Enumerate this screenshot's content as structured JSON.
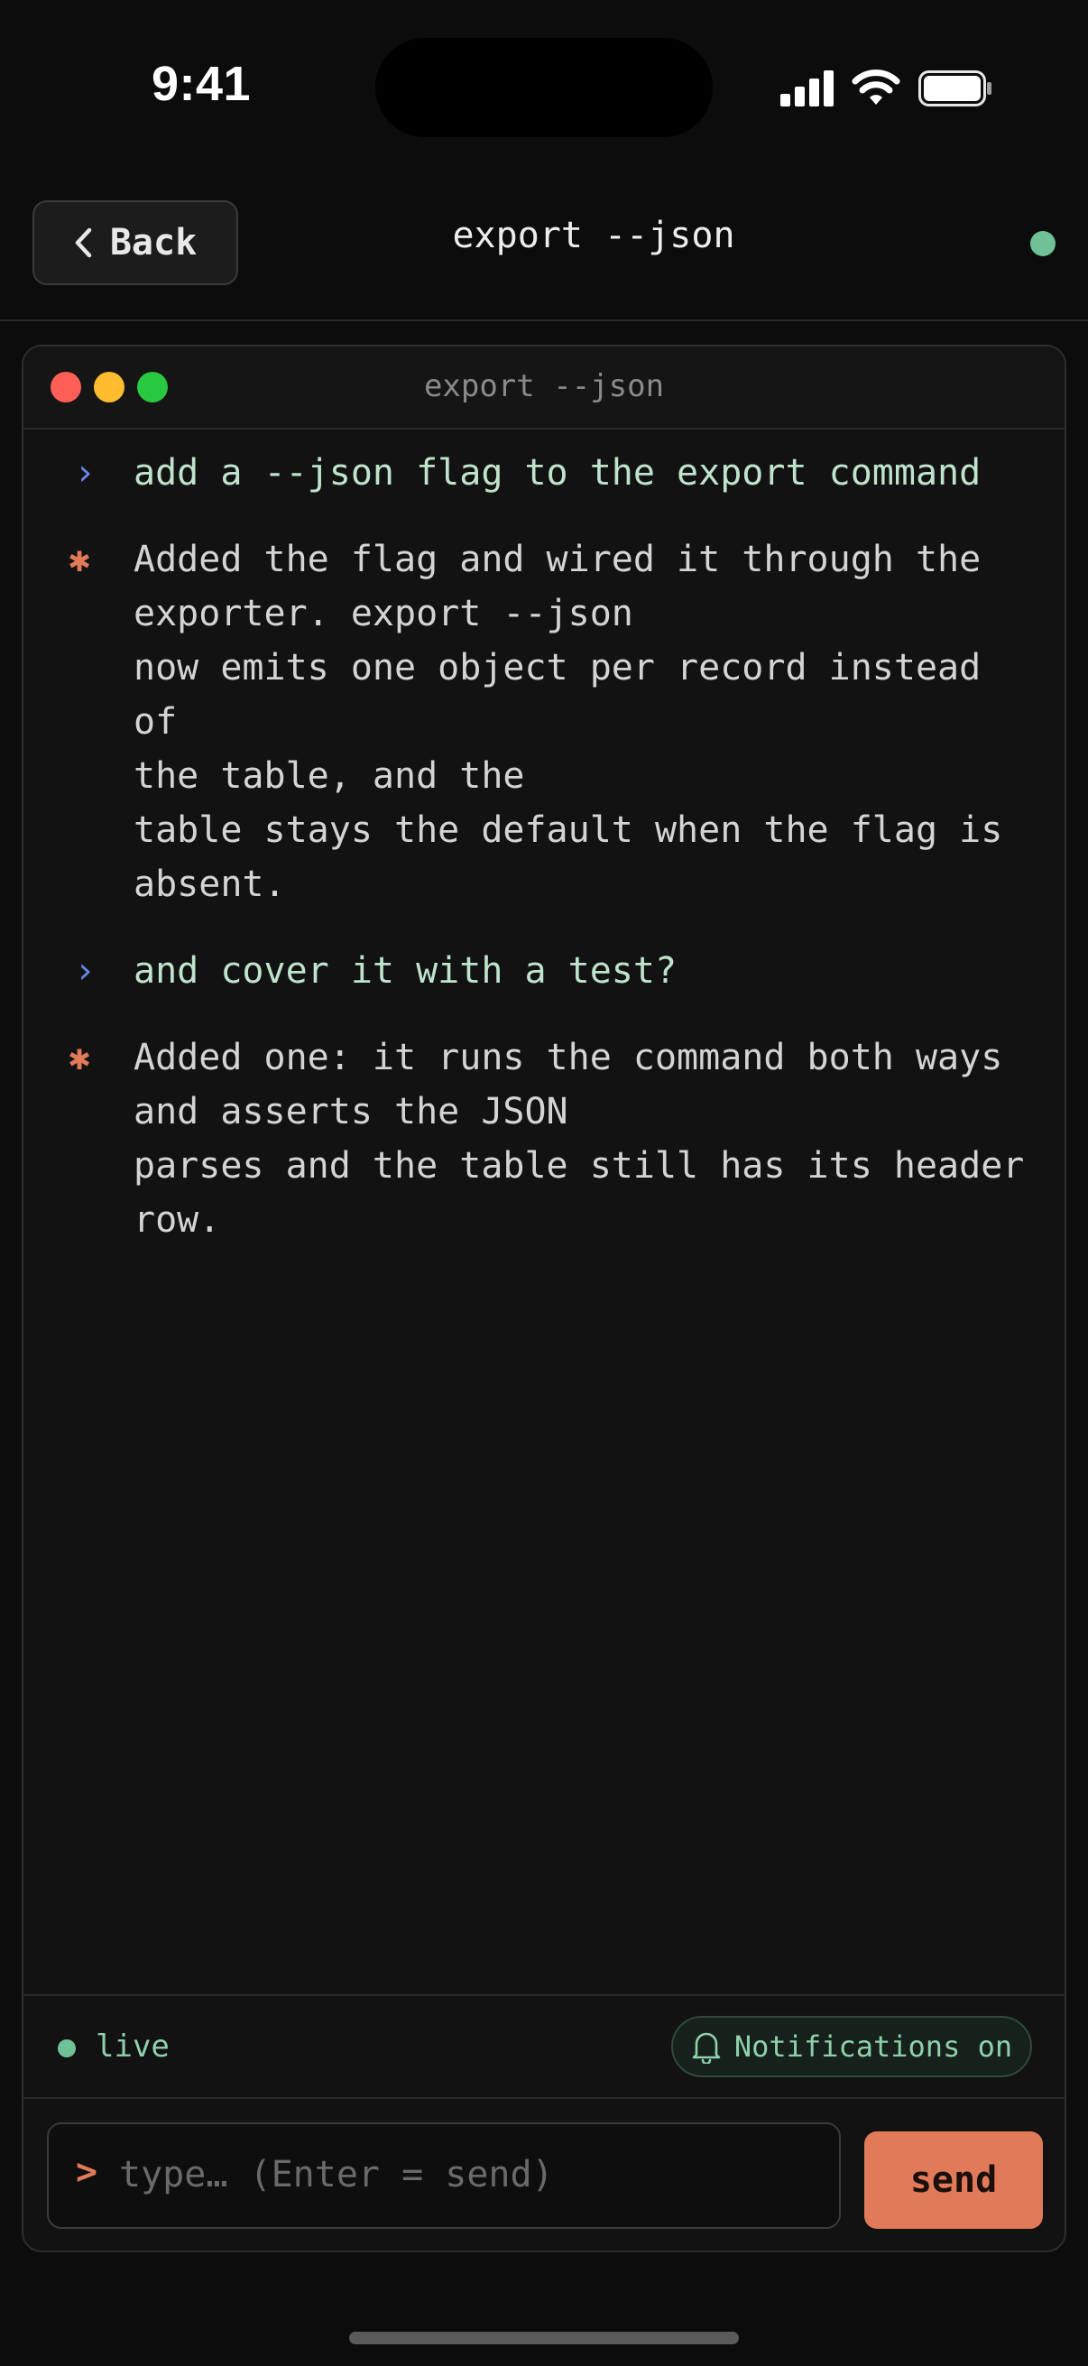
{
  "status_bar": {
    "time": "9:41"
  },
  "nav": {
    "back_label": "Back",
    "title": "export --json"
  },
  "terminal": {
    "title": "export --json",
    "messages": [
      {
        "role": "user",
        "marker": "›",
        "text": "add a --json flag to the export command"
      },
      {
        "role": "assistant",
        "marker": "✱",
        "text": "Added the flag and wired it through the\nexporter. export --json\nnow emits one object per record instead of\nthe table, and the\ntable stays the default when the flag is\nabsent."
      },
      {
        "role": "user",
        "marker": "›",
        "text": "and cover it with a test?"
      },
      {
        "role": "assistant",
        "marker": "✱",
        "text": "Added one: it runs the command both ways\nand asserts the JSON\nparses and the table still has its header\nrow."
      }
    ]
  },
  "footer": {
    "live_label": "live",
    "notifications_label": "Notifications on",
    "prompt_symbol": ">",
    "input_placeholder": "type… (Enter = send)",
    "input_value": "",
    "send_label": "send"
  },
  "colors": {
    "accent": "#e07a58",
    "live_green": "#6fc197",
    "user_text": "#bfe3cc",
    "user_marker": "#6b86e6"
  }
}
